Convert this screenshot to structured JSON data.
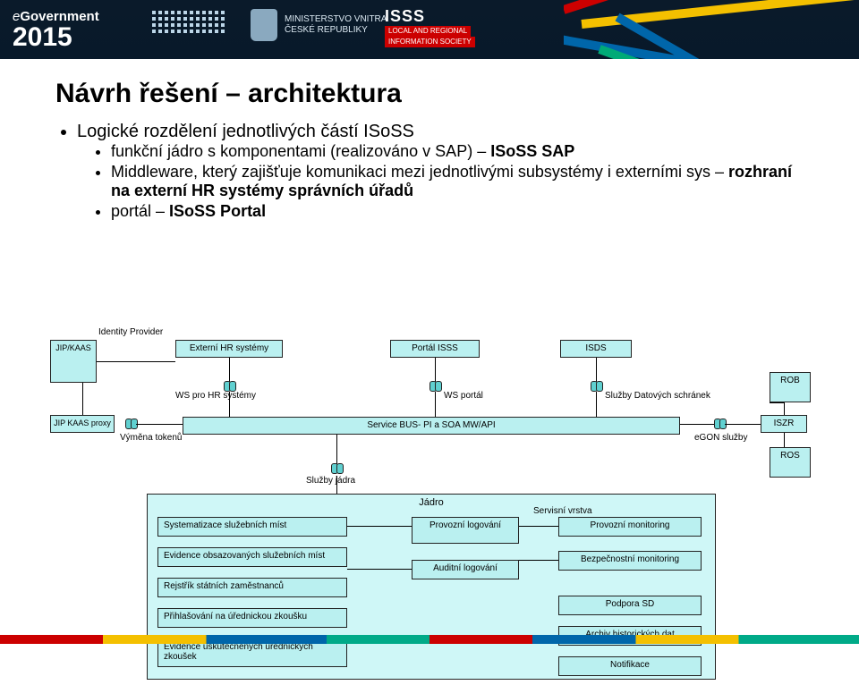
{
  "header": {
    "logo_prefix": "e",
    "logo_word": "Government",
    "logo_year": "2015",
    "ministry_line1": "MINISTERSTVO VNITRA",
    "ministry_line2": "ČESKÉ REPUBLIKY",
    "isss_title": "ISSS",
    "isss_box1": "LOCAL AND REGIONAL",
    "isss_box2": "INFORMATION SOCIETY"
  },
  "title": "Návrh řešení – architektura",
  "bullet_main": "Logické rozdělení jednotlivých částí ISoSS",
  "bullets": {
    "b1a": "funkční jádro s komponentami (realizováno v SAP) – ",
    "b1b": "ISoSS SAP",
    "b2a": "Middleware, který zajišťuje komunikaci mezi jednotlivými subsystémy i externími sys – ",
    "b2b": "rozhraní na externí HR systémy správních úřadů",
    "b3a": "portál – ",
    "b3b": "ISoSS Portal"
  },
  "diag": {
    "idp": "Identity Provider",
    "jip": "JIP/KAAS",
    "exthr": "Externí HR systémy",
    "portal": "Portál ISSS",
    "isds": "ISDS",
    "wshr": "WS pro HR systémy",
    "wsp": "WS portál",
    "sds": "Služby Datových schránek",
    "rob": "ROB",
    "proxy": "JIP KAAS proxy",
    "tok": "Výměna tokenů",
    "bus": "Service BUS- PI a SOA MW/API",
    "egon": "eGON služby",
    "iszr": "ISZR",
    "ros": "ROS",
    "sluzby": "Služby jádra",
    "jadro": "Jádro",
    "serv": "Servisní vrstva",
    "sys1": "Systematizace služebních míst",
    "sys2": "Evidence obsazovaných služebních míst",
    "sys3": "Rejstřík státních zaměstnanců",
    "sys4": "Přihlašování na úřednickou zkoušku",
    "sys5": "Evidence uskutečněných úřednických zkoušek",
    "pl": "Provozní logování",
    "al": "Auditní logování",
    "pm": "Provozní monitoring",
    "bm": "Bezpečnostní monitoring",
    "ps": "Podpora SD",
    "ah": "Archiv historických dat",
    "nt": "Notifikace"
  }
}
